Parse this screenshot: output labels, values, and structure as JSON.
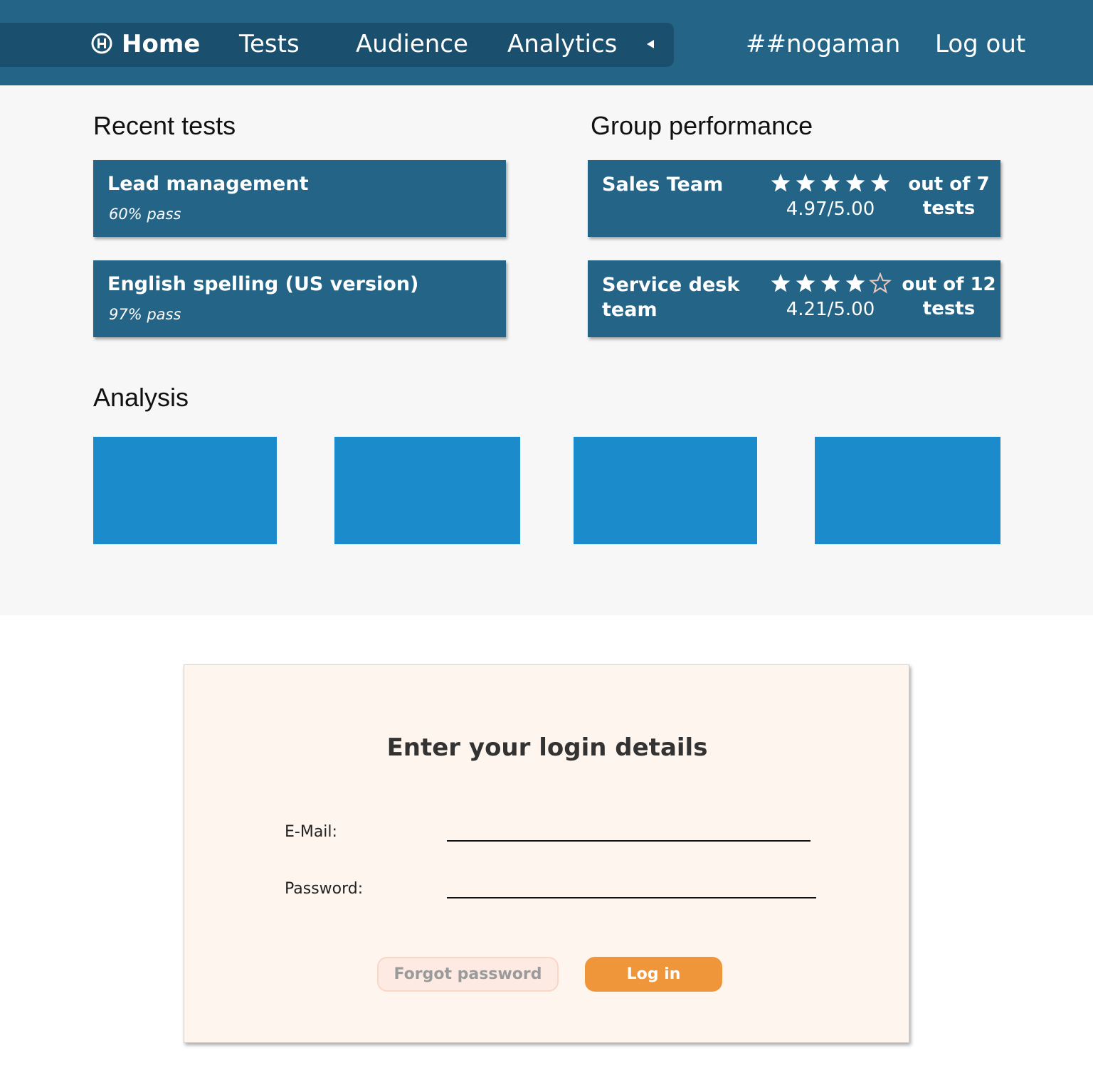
{
  "nav": {
    "home": "Home",
    "tests": "Tests",
    "audience": "Audience",
    "analytics": "Analytics",
    "user": "##nogaman",
    "logout": "Log out",
    "colors": {
      "bar": "#246487",
      "pill": "#1b4f6e"
    }
  },
  "dashboard": {
    "recent_title": "Recent tests",
    "group_title": "Group performance",
    "analysis_title": "Analysis",
    "recent_tests": [
      {
        "title": "Lead management",
        "pass": "60% pass"
      },
      {
        "title": "English spelling (US version)",
        "pass": "97% pass"
      }
    ],
    "groups": [
      {
        "name": "Sales Team",
        "rating": "4.97/5.00",
        "stars_filled": 5,
        "stars_total": 5,
        "out_of": "out of 7 tests"
      },
      {
        "name": "Service desk team",
        "rating": "4.21/5.00",
        "stars_filled": 4,
        "stars_total": 5,
        "out_of": "out of 12 tests"
      }
    ],
    "analysis_tiles": 4,
    "colors": {
      "card": "#246487",
      "tile": "#1c8bcb",
      "background": "#f7f7f7"
    }
  },
  "login": {
    "title": "Enter your login details",
    "email_label": "E-Mail:",
    "email_value": "",
    "password_label": "Password:",
    "password_value": "",
    "forgot_label": "Forgot password",
    "login_label": "Log in",
    "colors": {
      "panel": "#fdf5ee",
      "primary": "#f0963a",
      "secondary": "#fdebe3"
    }
  }
}
